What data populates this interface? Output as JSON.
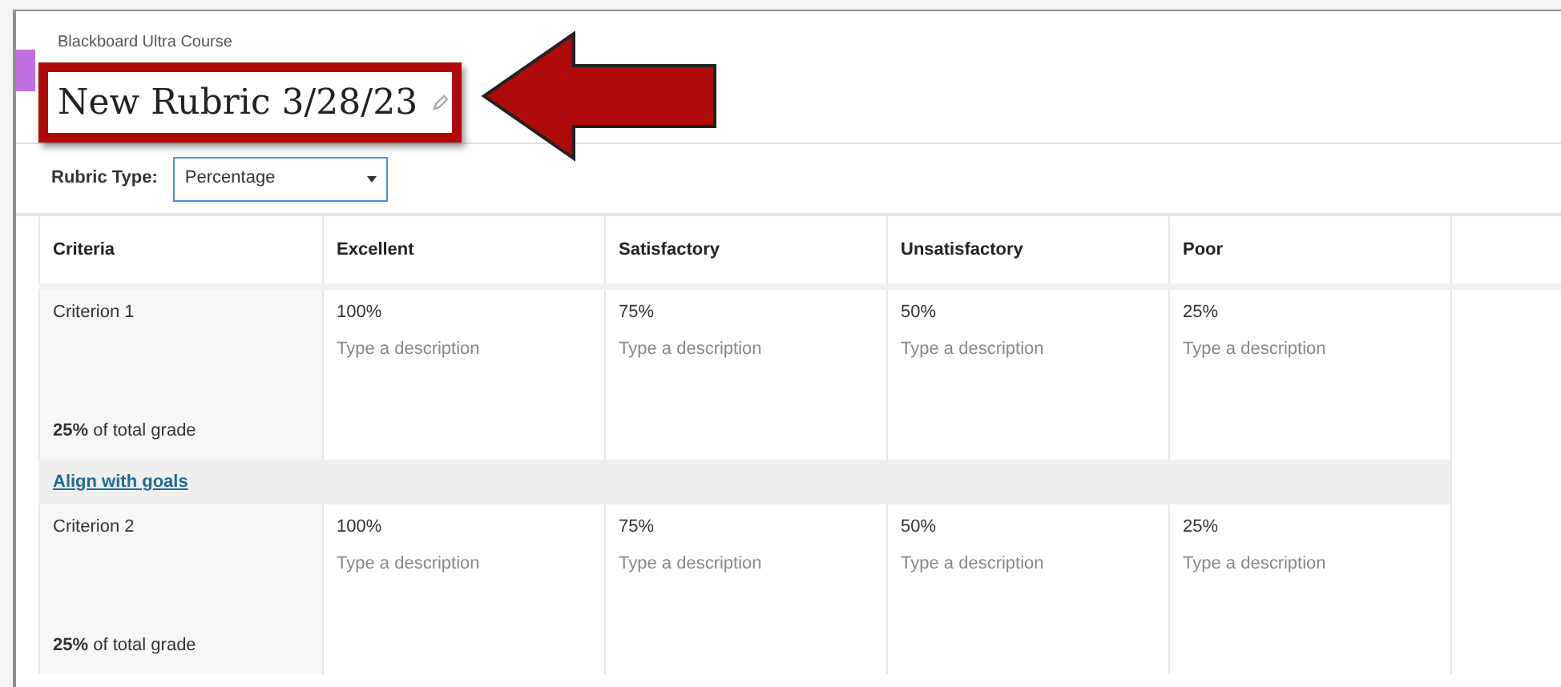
{
  "breadcrumb": "Blackboard Ultra Course",
  "title": "New Rubric 3/28/23",
  "rubric_type": {
    "label": "Rubric Type:",
    "value": "Percentage"
  },
  "table": {
    "columns": [
      "Criteria",
      "Excellent",
      "Satisfactory",
      "Unsatisfactory",
      "Poor"
    ],
    "rows": [
      {
        "cells": [
          {
            "kind": "criterion",
            "name": "Criterion 1",
            "weight": "**25%** of total grade"
          },
          {
            "kind": "level",
            "value": "100%",
            "placeholder": "Type a description"
          },
          {
            "kind": "level",
            "value": "75%",
            "placeholder": "Type a description"
          },
          {
            "kind": "level",
            "value": "50%",
            "placeholder": "Type a description"
          },
          {
            "kind": "level",
            "value": "25%",
            "placeholder": "Type a description"
          }
        ],
        "link": "Align with goals"
      },
      {
        "cells": [
          {
            "kind": "criterion",
            "name": "Criterion 2",
            "weight": "**25%** of total grade"
          },
          {
            "kind": "level",
            "value": "100%",
            "placeholder": "Type a description"
          },
          {
            "kind": "level",
            "value": "75%",
            "placeholder": "Type a description"
          },
          {
            "kind": "level",
            "value": "50%",
            "placeholder": "Type a description"
          },
          {
            "kind": "level",
            "value": "25%",
            "placeholder": "Type a description"
          }
        ]
      }
    ]
  }
}
